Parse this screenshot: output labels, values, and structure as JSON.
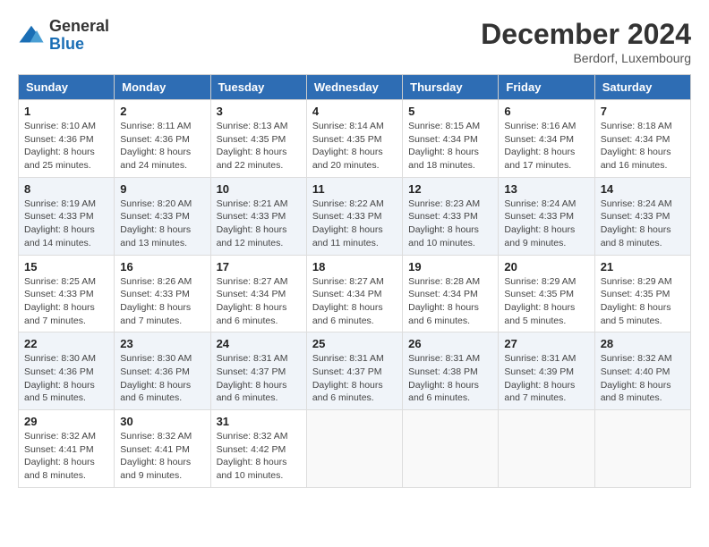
{
  "logo": {
    "general": "General",
    "blue": "Blue"
  },
  "title": "December 2024",
  "location": "Berdorf, Luxembourg",
  "days_of_week": [
    "Sunday",
    "Monday",
    "Tuesday",
    "Wednesday",
    "Thursday",
    "Friday",
    "Saturday"
  ],
  "weeks": [
    [
      {
        "day": "1",
        "sunrise": "8:10 AM",
        "sunset": "4:36 PM",
        "daylight": "8 hours and 25 minutes."
      },
      {
        "day": "2",
        "sunrise": "8:11 AM",
        "sunset": "4:36 PM",
        "daylight": "8 hours and 24 minutes."
      },
      {
        "day": "3",
        "sunrise": "8:13 AM",
        "sunset": "4:35 PM",
        "daylight": "8 hours and 22 minutes."
      },
      {
        "day": "4",
        "sunrise": "8:14 AM",
        "sunset": "4:35 PM",
        "daylight": "8 hours and 20 minutes."
      },
      {
        "day": "5",
        "sunrise": "8:15 AM",
        "sunset": "4:34 PM",
        "daylight": "8 hours and 18 minutes."
      },
      {
        "day": "6",
        "sunrise": "8:16 AM",
        "sunset": "4:34 PM",
        "daylight": "8 hours and 17 minutes."
      },
      {
        "day": "7",
        "sunrise": "8:18 AM",
        "sunset": "4:34 PM",
        "daylight": "8 hours and 16 minutes."
      }
    ],
    [
      {
        "day": "8",
        "sunrise": "8:19 AM",
        "sunset": "4:33 PM",
        "daylight": "8 hours and 14 minutes."
      },
      {
        "day": "9",
        "sunrise": "8:20 AM",
        "sunset": "4:33 PM",
        "daylight": "8 hours and 13 minutes."
      },
      {
        "day": "10",
        "sunrise": "8:21 AM",
        "sunset": "4:33 PM",
        "daylight": "8 hours and 12 minutes."
      },
      {
        "day": "11",
        "sunrise": "8:22 AM",
        "sunset": "4:33 PM",
        "daylight": "8 hours and 11 minutes."
      },
      {
        "day": "12",
        "sunrise": "8:23 AM",
        "sunset": "4:33 PM",
        "daylight": "8 hours and 10 minutes."
      },
      {
        "day": "13",
        "sunrise": "8:24 AM",
        "sunset": "4:33 PM",
        "daylight": "8 hours and 9 minutes."
      },
      {
        "day": "14",
        "sunrise": "8:24 AM",
        "sunset": "4:33 PM",
        "daylight": "8 hours and 8 minutes."
      }
    ],
    [
      {
        "day": "15",
        "sunrise": "8:25 AM",
        "sunset": "4:33 PM",
        "daylight": "8 hours and 7 minutes."
      },
      {
        "day": "16",
        "sunrise": "8:26 AM",
        "sunset": "4:33 PM",
        "daylight": "8 hours and 7 minutes."
      },
      {
        "day": "17",
        "sunrise": "8:27 AM",
        "sunset": "4:34 PM",
        "daylight": "8 hours and 6 minutes."
      },
      {
        "day": "18",
        "sunrise": "8:27 AM",
        "sunset": "4:34 PM",
        "daylight": "8 hours and 6 minutes."
      },
      {
        "day": "19",
        "sunrise": "8:28 AM",
        "sunset": "4:34 PM",
        "daylight": "8 hours and 6 minutes."
      },
      {
        "day": "20",
        "sunrise": "8:29 AM",
        "sunset": "4:35 PM",
        "daylight": "8 hours and 5 minutes."
      },
      {
        "day": "21",
        "sunrise": "8:29 AM",
        "sunset": "4:35 PM",
        "daylight": "8 hours and 5 minutes."
      }
    ],
    [
      {
        "day": "22",
        "sunrise": "8:30 AM",
        "sunset": "4:36 PM",
        "daylight": "8 hours and 5 minutes."
      },
      {
        "day": "23",
        "sunrise": "8:30 AM",
        "sunset": "4:36 PM",
        "daylight": "8 hours and 6 minutes."
      },
      {
        "day": "24",
        "sunrise": "8:31 AM",
        "sunset": "4:37 PM",
        "daylight": "8 hours and 6 minutes."
      },
      {
        "day": "25",
        "sunrise": "8:31 AM",
        "sunset": "4:37 PM",
        "daylight": "8 hours and 6 minutes."
      },
      {
        "day": "26",
        "sunrise": "8:31 AM",
        "sunset": "4:38 PM",
        "daylight": "8 hours and 6 minutes."
      },
      {
        "day": "27",
        "sunrise": "8:31 AM",
        "sunset": "4:39 PM",
        "daylight": "8 hours and 7 minutes."
      },
      {
        "day": "28",
        "sunrise": "8:32 AM",
        "sunset": "4:40 PM",
        "daylight": "8 hours and 8 minutes."
      }
    ],
    [
      {
        "day": "29",
        "sunrise": "8:32 AM",
        "sunset": "4:41 PM",
        "daylight": "8 hours and 8 minutes."
      },
      {
        "day": "30",
        "sunrise": "8:32 AM",
        "sunset": "4:41 PM",
        "daylight": "8 hours and 9 minutes."
      },
      {
        "day": "31",
        "sunrise": "8:32 AM",
        "sunset": "4:42 PM",
        "daylight": "8 hours and 10 minutes."
      },
      null,
      null,
      null,
      null
    ]
  ],
  "labels": {
    "sunrise": "Sunrise:",
    "sunset": "Sunset:",
    "daylight": "Daylight:"
  }
}
